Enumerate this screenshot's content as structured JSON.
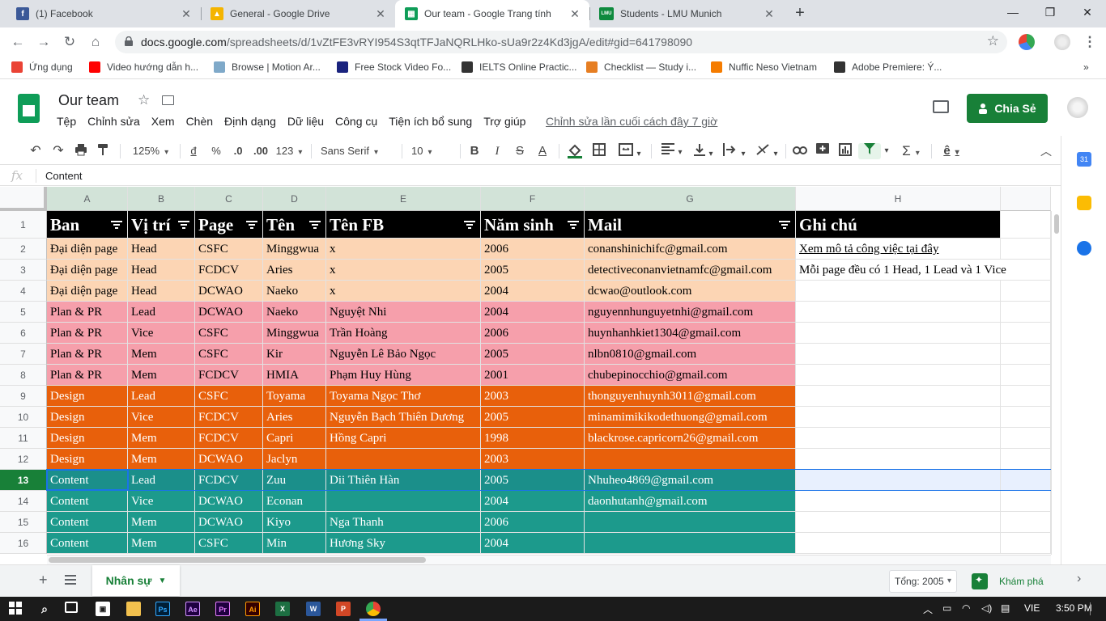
{
  "browser": {
    "tabs": [
      {
        "title": "(1) Facebook",
        "color": "#3b5998",
        "glyph": "f"
      },
      {
        "title": "General - Google Drive",
        "color": "#f4b400",
        "glyph": "▲"
      },
      {
        "title": "Our team - Google Trang tính",
        "color": "#0f9d58",
        "glyph": "▦"
      },
      {
        "title": "Students - LMU Munich",
        "color": "#0e8a3e",
        "glyph": "LMU"
      }
    ],
    "url_host": "docs.google.com",
    "url_path": "/spreadsheets/d/1vZtFE3vRYI954S3qtTFJaNQRLHko-sUa9r2z4Kd3jgA/edit#gid=641798090",
    "bookmarks": [
      {
        "label": "Ứng dụng",
        "icon": "apps-grid-icon",
        "color": "#ea4335"
      },
      {
        "label": "Video hướng dẫn h...",
        "icon": "video-icon",
        "color": "#ff0000"
      },
      {
        "label": "Browse | Motion Ar...",
        "icon": "motion-icon",
        "color": "#7fa9c9"
      },
      {
        "label": "Free Stock Video Fo...",
        "icon": "v-icon",
        "color": "#1a237e"
      },
      {
        "label": "IELTS Online Practic...",
        "icon": "ielts-icon",
        "color": "#333"
      },
      {
        "label": "Checklist — Study i...",
        "icon": "checklist-icon",
        "color": "#e67e22"
      },
      {
        "label": "Nuffic Neso Vietnam",
        "icon": "nuffic-icon",
        "color": "#f57c00"
      },
      {
        "label": "Adobe Premiere: Ý...",
        "icon": "globe-icon",
        "color": "#333"
      }
    ]
  },
  "doc": {
    "title": "Our team",
    "menu": [
      "Tệp",
      "Chỉnh sửa",
      "Xem",
      "Chèn",
      "Định dạng",
      "Dữ liệu",
      "Công cụ",
      "Tiện ích bổ sung",
      "Trợ giúp"
    ],
    "last_edit": "Chỉnh sửa lần cuối cách đây 7 giờ",
    "share_label": "Chia Sẻ"
  },
  "toolbar": {
    "zoom": "125%",
    "currency": "đ",
    "percent": "%",
    "dec_less": ".0",
    "dec_more": ".00",
    "format_more": "123",
    "font": "Sans Serif",
    "font_size": "10"
  },
  "formula": {
    "fx": "fx",
    "value": "Content"
  },
  "columns": [
    "A",
    "B",
    "C",
    "D",
    "E",
    "F",
    "G",
    "H"
  ],
  "header_row": [
    "Ban",
    "Vị trí",
    "Page",
    "Tên",
    "Tên FB",
    "Năm sinh",
    "Mail",
    "Ghi chú"
  ],
  "rows": [
    {
      "n": "2",
      "cells": [
        "Đại diện page",
        "Head",
        "CSFC",
        "Minggwua",
        "x",
        "2006",
        "conanshinichifc@gmail.com",
        "Xem mô tả công việc tại đây"
      ],
      "style": "c-peach"
    },
    {
      "n": "3",
      "cells": [
        "Đại diện page",
        "Head",
        "FCDCV",
        "Aries",
        "x",
        "2005",
        "detectiveconanvietnamfc@gmail.com",
        "Mỗi page đều có 1 Head, 1 Lead và 1 Vice"
      ],
      "style": "c-peach"
    },
    {
      "n": "4",
      "cells": [
        "Đại diện page",
        "Head",
        "DCWAO",
        "Naeko",
        "x",
        "2004",
        "dcwao@outlook.com",
        ""
      ],
      "style": "c-peach"
    },
    {
      "n": "5",
      "cells": [
        "Plan & PR",
        "Lead",
        "DCWAO",
        "Naeko",
        "Nguyệt Nhi",
        "2004",
        "nguyennhunguyetnhi@gmail.com",
        ""
      ],
      "style": "c-pink"
    },
    {
      "n": "6",
      "cells": [
        "Plan & PR",
        "Vice",
        "CSFC",
        "Minggwua",
        "Trần Hoàng",
        "2006",
        "huynhanhkiet1304@gmail.com",
        ""
      ],
      "style": "c-pink"
    },
    {
      "n": "7",
      "cells": [
        "Plan & PR",
        "Mem",
        "CSFC",
        "Kir",
        "Nguyễn Lê Bảo Ngọc",
        "2005",
        "nlbn0810@gmail.com",
        ""
      ],
      "style": "c-pink"
    },
    {
      "n": "8",
      "cells": [
        "Plan & PR",
        "Mem",
        "FCDCV",
        "HMIA",
        "Phạm Huy Hùng",
        "2001",
        "chubepinocchio@gmail.com",
        ""
      ],
      "style": "c-pink"
    },
    {
      "n": "9",
      "cells": [
        "Design",
        "Lead",
        "CSFC",
        "Toyama",
        "Toyama Ngọc Thơ",
        "2003",
        "thonguyenhuynh3011@gmail.com",
        ""
      ],
      "style": "c-orange"
    },
    {
      "n": "10",
      "cells": [
        "Design",
        "Vice",
        "FCDCV",
        "Aries",
        "Nguyễn Bạch Thiên Dương",
        "2005",
        "minamimikikodethuong@gmail.com",
        ""
      ],
      "style": "c-orange"
    },
    {
      "n": "11",
      "cells": [
        "Design",
        "Mem",
        "FCDCV",
        "Capri",
        "Hồng Capri",
        "1998",
        "blackrose.capricorn26@gmail.com",
        ""
      ],
      "style": "c-orange"
    },
    {
      "n": "12",
      "cells": [
        "Design",
        "Mem",
        "DCWAO",
        "Jaclyn",
        "",
        "2003",
        "",
        ""
      ],
      "style": "c-orange"
    },
    {
      "n": "13",
      "cells": [
        "Content",
        "Lead",
        "FCDCV",
        "Zuu",
        "Dii Thiên Hàn",
        "2005",
        "Nhuheo4869@gmail.com",
        ""
      ],
      "style": "c-teal2"
    },
    {
      "n": "14",
      "cells": [
        "Content",
        "Vice",
        "DCWAO",
        "Econan",
        "",
        "2004",
        "daonhutanh@gmail.com",
        ""
      ],
      "style": "c-teal"
    },
    {
      "n": "15",
      "cells": [
        "Content",
        "Mem",
        "DCWAO",
        "Kiyo",
        "Nga Thanh",
        "2006",
        "",
        ""
      ],
      "style": "c-teal"
    },
    {
      "n": "16",
      "cells": [
        "Content",
        "Mem",
        "CSFC",
        "Min",
        "Hương Sky",
        "2004",
        "",
        ""
      ],
      "style": "c-teal"
    }
  ],
  "sheet": {
    "name": "Nhân sự",
    "sum": "Tổng: 2005",
    "explore": "Khám phá"
  },
  "taskbar": {
    "lang": "VIE",
    "time": "3:50 PM"
  }
}
